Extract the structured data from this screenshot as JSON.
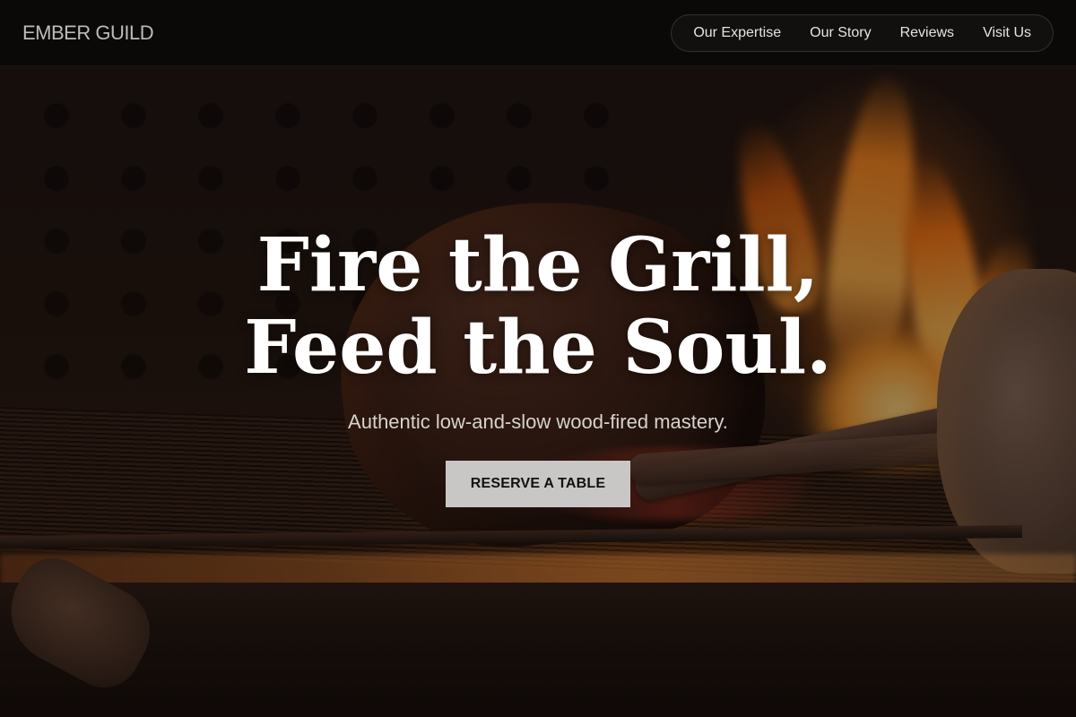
{
  "header": {
    "brand": "EMBER GUILD",
    "nav": [
      {
        "label": "Our Expertise"
      },
      {
        "label": "Our Story"
      },
      {
        "label": "Reviews"
      },
      {
        "label": "Visit Us"
      }
    ]
  },
  "hero": {
    "headline_line1": "Fire the Grill,",
    "headline_line2": "Feed the Soul.",
    "subtitle": "Authentic low-and-slow wood-fired mastery.",
    "cta_label": "RESERVE A TABLE"
  },
  "colors": {
    "header_bg": "#0b0908",
    "cta_bg": "#c9c7c5",
    "flame": "#ff8a1e"
  }
}
